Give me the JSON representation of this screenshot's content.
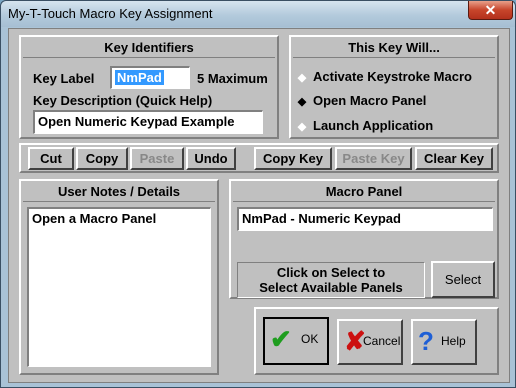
{
  "window": {
    "title": "My-T-Touch Macro Key Assignment",
    "close_symbol": "✕"
  },
  "key_identifiers": {
    "heading": "Key Identifiers",
    "key_label_caption": "Key Label",
    "key_label_value": "NmPad",
    "max_note": "5 Maximum",
    "description_caption": "Key Description (Quick Help)",
    "description_value": "Open Numeric Keypad Example"
  },
  "this_key_will": {
    "heading": "This Key Will...",
    "options": [
      {
        "label": "Activate Keystroke Macro",
        "selected": false
      },
      {
        "label": "Open Macro Panel",
        "selected": true
      },
      {
        "label": "Launch Application",
        "selected": false
      }
    ]
  },
  "edit_buttons": {
    "cut": "Cut",
    "copy": "Copy",
    "paste": "Paste",
    "undo": "Undo",
    "copy_key": "Copy Key",
    "paste_key": "Paste Key",
    "clear_key": "Clear Key"
  },
  "user_notes": {
    "heading": "User Notes / Details",
    "text": "Open a Macro Panel"
  },
  "macro_panel": {
    "heading": "Macro Panel",
    "value": "NmPad - Numeric Keypad",
    "hint_line1": "Click on Select to",
    "hint_line2": "Select Available Panels",
    "select": "Select"
  },
  "dialog_buttons": {
    "ok": "OK",
    "cancel": "Cancel",
    "help": "Help"
  },
  "colors": {
    "accent_selection": "#3399ff",
    "ok_check": "#1f9d1f",
    "cancel_x": "#cc1111",
    "help_q": "#1e5fd6"
  }
}
